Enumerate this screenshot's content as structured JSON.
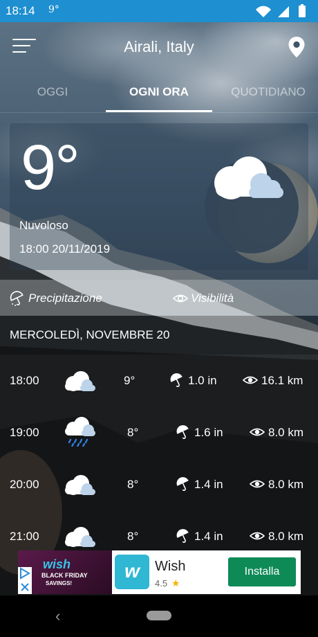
{
  "status_bar": {
    "time": "18:14",
    "temp": "9°",
    "background_color": "#1e8fd0"
  },
  "app_bar": {
    "title": "Airali, Italy",
    "menu_icon": "hamburger-icon",
    "location_icon": "map-pin-icon"
  },
  "tabs": [
    {
      "label": "OGGI",
      "active": false
    },
    {
      "label": "OGNI ORA",
      "active": true
    },
    {
      "label": "QUOTIDIANO",
      "active": false
    }
  ],
  "current": {
    "temperature": "9°",
    "condition": "Nuvoloso",
    "datetime": "18:00 20/11/2019",
    "icon": "cloud-icon"
  },
  "columns": {
    "precipitation": "Precipitazione",
    "visibility": "Visibilità"
  },
  "day_label": "MERCOLEDÌ, NOVEMBRE 20",
  "hourly": [
    {
      "time": "18:00",
      "icon": "cloud-icon",
      "temp": "9°",
      "precip": "1.0 in",
      "visibility": "16.1 km"
    },
    {
      "time": "19:00",
      "icon": "rain-cloud-icon",
      "temp": "8°",
      "precip": "1.6 in",
      "visibility": "8.0 km"
    },
    {
      "time": "20:00",
      "icon": "cloud-icon",
      "temp": "8°",
      "precip": "1.4 in",
      "visibility": "8.0 km"
    },
    {
      "time": "21:00",
      "icon": "cloud-icon",
      "temp": "8°",
      "precip": "1.4 in",
      "visibility": "8.0 km"
    }
  ],
  "ad": {
    "image_brand": "wish",
    "image_line1": "BLACK FRIDAY",
    "image_line2": "SAVINGS!",
    "logo_letter": "w",
    "title": "Wish",
    "rating": "4.5",
    "star": "★",
    "button_label": "Installa",
    "button_color": "#0e8a57"
  },
  "nav": {
    "back_glyph": "‹"
  }
}
